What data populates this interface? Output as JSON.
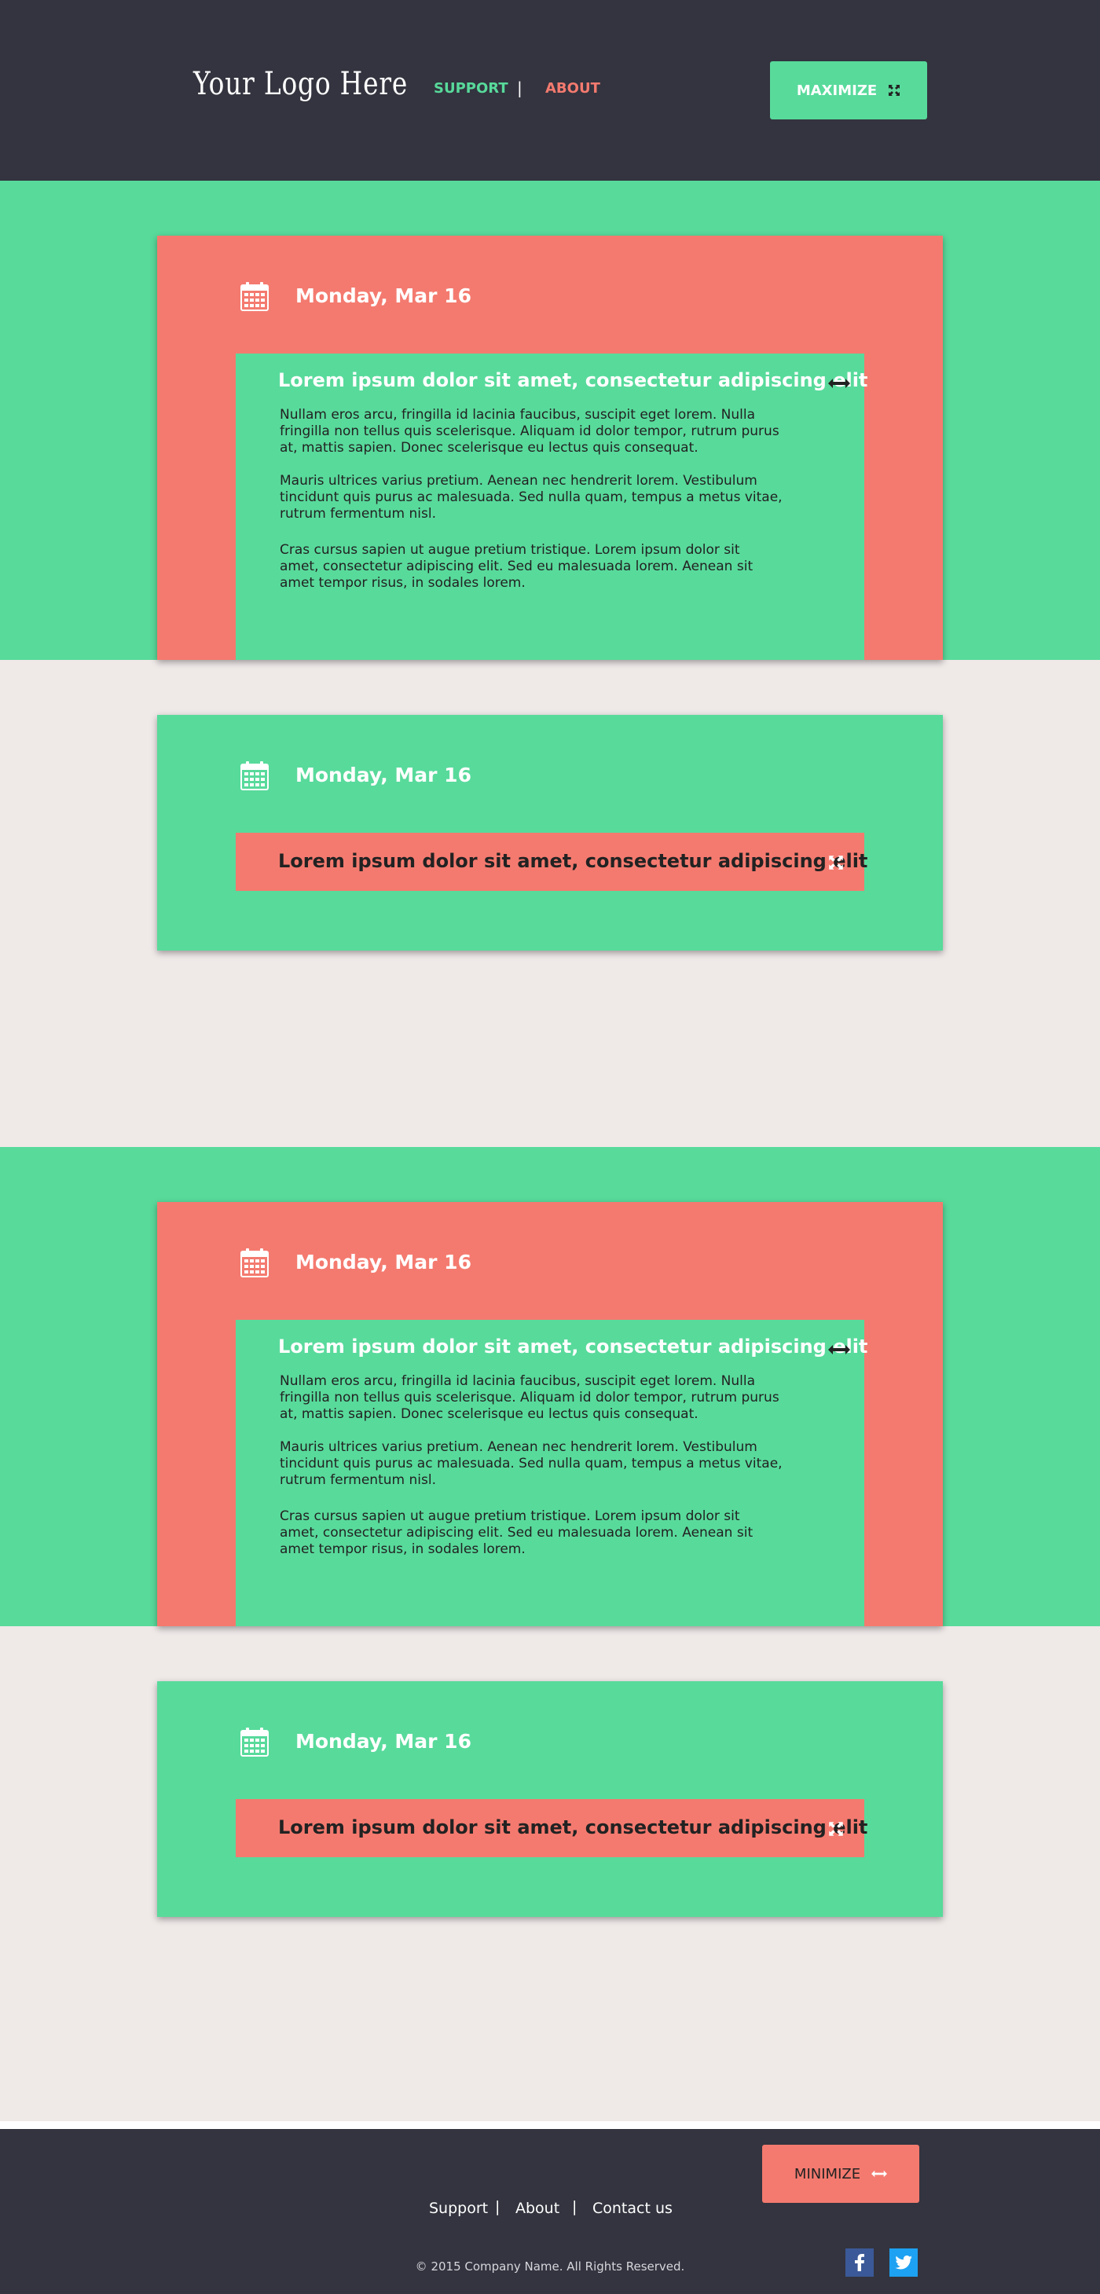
{
  "header": {
    "logo": "Your Logo Here",
    "nav_support": "SUPPORT",
    "nav_separator": "|",
    "nav_about": "ABOUT",
    "maximize_label": "MAXIMIZE"
  },
  "cards": [
    {
      "date": "Monday, Mar 16",
      "title": "Lorem ipsum dolor sit amet, consectetur adipiscing elit",
      "paragraphs": [
        "Nullam eros arcu, fringilla id lacinia faucibus, suscipit eget lorem. Nulla fringilla non tellus quis scelerisque. Aliquam id dolor tempor, rutrum purus at, mattis sapien. Donec scelerisque eu lectus quis consequat.",
        "Mauris ultrices varius pretium. Aenean nec hendrerit lorem. Vestibulum tincidunt quis purus ac malesuada. Sed nulla quam, tempus a metus vitae, rutrum fermentum nisl.",
        "Cras cursus sapien ut augue pretium tristique. Lorem ipsum dolor sit amet, consectetur adipiscing elit. Sed eu malesuada lorem. Aenean sit amet tempor risus, in sodales lorem."
      ]
    },
    {
      "date": "Monday, Mar 16",
      "title": "Lorem ipsum dolor sit amet, consectetur adipiscing elit"
    },
    {
      "date": "Monday, Mar 16",
      "title": "Lorem ipsum dolor sit amet, consectetur adipiscing elit",
      "paragraphs": [
        "Nullam eros arcu, fringilla id lacinia faucibus, suscipit eget lorem. Nulla fringilla non tellus quis scelerisque. Aliquam id dolor tempor, rutrum purus at, mattis sapien. Donec scelerisque eu lectus quis consequat.",
        "Mauris ultrices varius pretium. Aenean nec hendrerit lorem. Vestibulum tincidunt quis purus ac malesuada. Sed nulla quam, tempus a metus vitae, rutrum fermentum nisl.",
        "Cras cursus sapien ut augue pretium tristique. Lorem ipsum dolor sit amet, consectetur adipiscing elit. Sed eu malesuada lorem. Aenean sit amet tempor risus, in sodales lorem."
      ]
    },
    {
      "date": "Monday, Mar 16",
      "title": "Lorem ipsum dolor sit amet, consectetur adipiscing elit"
    }
  ],
  "footer": {
    "minimize_label": "MINIMIZE",
    "links": [
      "Support",
      "About",
      "Contact us"
    ],
    "separator": "|",
    "copyright": "© 2015 Company Name.  All Rights Reserved.",
    "social": [
      {
        "name": "facebook-icon",
        "glyph": "f",
        "color": "#3b5998"
      },
      {
        "name": "twitter-icon",
        "glyph": "t",
        "color": "#1da1f2"
      }
    ]
  },
  "colors": {
    "dark": "#33343f",
    "green": "#58da9b",
    "coral": "#f47a6f",
    "background": "#efe9e8"
  }
}
